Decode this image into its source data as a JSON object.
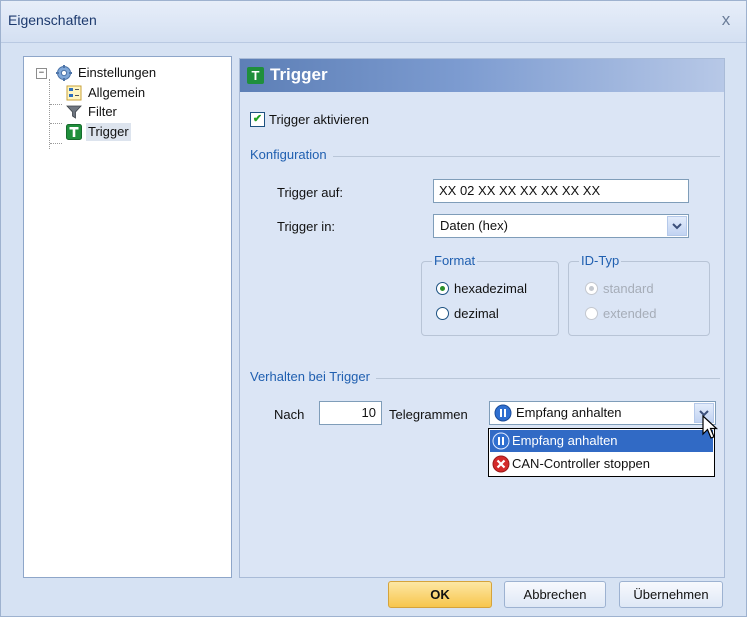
{
  "window": {
    "title": "Eigenschaften",
    "close_glyph": "x"
  },
  "tree": {
    "root": {
      "label": "Einstellungen",
      "expander": "−",
      "icon": "gear-icon"
    },
    "children": [
      {
        "label": "Allgemein",
        "icon": "general-settings-icon"
      },
      {
        "label": "Filter",
        "icon": "funnel-icon"
      },
      {
        "label": "Trigger",
        "icon": "trigger-icon",
        "selected": true
      }
    ]
  },
  "panel": {
    "header_title": "Trigger",
    "header_icon_letter": "T",
    "activate_checkbox": {
      "label": "Trigger aktivieren",
      "checked": true
    },
    "config_section": "Konfiguration",
    "trigger_on_label": "Trigger auf:",
    "trigger_on_value": "XX 02 XX XX XX XX XX XX",
    "trigger_in_label": "Trigger in:",
    "trigger_in_value": "Daten (hex)",
    "format_group": {
      "title": "Format",
      "options": [
        {
          "label": "hexadezimal",
          "checked": true
        },
        {
          "label": "dezimal",
          "checked": false
        }
      ]
    },
    "id_type_group": {
      "title": "ID-Typ",
      "disabled": true,
      "options": [
        {
          "label": "standard",
          "checked": true
        },
        {
          "label": "extended",
          "checked": false
        }
      ]
    },
    "behavior_section": "Verhalten bei Trigger",
    "after_label": "Nach",
    "after_value": "10",
    "telegrams_label": "Telegrammen",
    "action_value": "Empfang anhalten",
    "action_options": [
      {
        "label": "Empfang anhalten",
        "icon": "pause-icon",
        "highlighted": true
      },
      {
        "label": "CAN-Controller stoppen",
        "icon": "stop-icon",
        "highlighted": false
      }
    ]
  },
  "buttons": {
    "ok": "OK",
    "cancel": "Abbrechen",
    "apply": "Übernehmen"
  },
  "colors": {
    "dialog_bg": "#d6e2f3",
    "header_gradient_start": "#5d7fb6",
    "section_text": "#1f5fb0",
    "selection": "#316ac5",
    "ok_button": "#f7c64d"
  }
}
